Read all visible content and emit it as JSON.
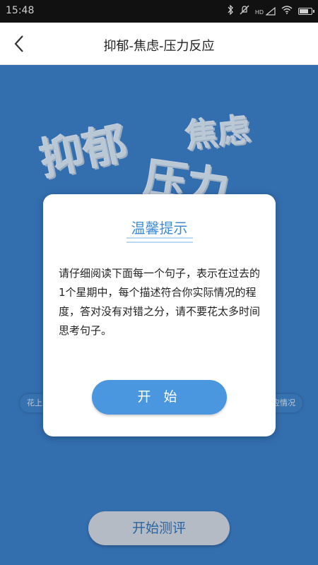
{
  "status_bar": {
    "time": "15:48",
    "signal_text": "HD",
    "icons": [
      "bluetooth-icon",
      "mute-icon",
      "signal-icon",
      "wifi-icon",
      "battery-icon"
    ],
    "battery_level": 0.8
  },
  "header": {
    "title": "抑郁-焦虑-压力反应"
  },
  "hero": {
    "word_1": "抑郁",
    "word_2": "焦虑",
    "word_3": "压力"
  },
  "tags": {
    "left": "花上",
    "right": "应情况"
  },
  "start_eval_button": "开始测评",
  "dialog": {
    "title": "温馨提示",
    "body": "请仔细阅读下面每一个句子，表示在过去的1个星期中，每个描述符合你实际情况的程度，答对没有对错之分，请不要花太多时间思考句子。",
    "start_button": "开 始"
  },
  "colors": {
    "page_background": "#3a7cc2",
    "accent": "#4a97e0",
    "dialog_title": "#3d8bd6",
    "status_bar": "#111111"
  }
}
